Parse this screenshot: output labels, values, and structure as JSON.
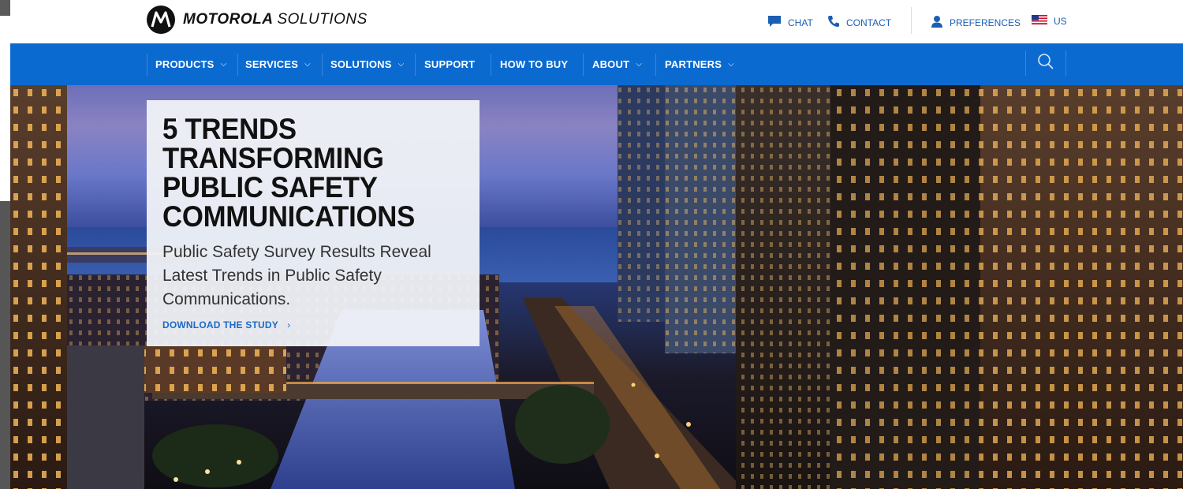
{
  "brand": {
    "name_bold": "MOTOROLA",
    "name_light": "SOLUTIONS",
    "logo_icon": "motorola-m-logo-icon"
  },
  "utility": {
    "chat": "CHAT",
    "contact": "CONTACT",
    "preferences": "PREFERENCES",
    "region": "US"
  },
  "nav": {
    "items": [
      {
        "label": "PRODUCTS",
        "dropdown": true
      },
      {
        "label": "SERVICES",
        "dropdown": true
      },
      {
        "label": "SOLUTIONS",
        "dropdown": true
      },
      {
        "label": "SUPPORT",
        "dropdown": false
      },
      {
        "label": "HOW TO BUY",
        "dropdown": false
      },
      {
        "label": "ABOUT",
        "dropdown": true
      },
      {
        "label": "PARTNERS",
        "dropdown": true
      }
    ],
    "search_icon": "search-icon"
  },
  "hero": {
    "title": "5 TRENDS TRANSFORMING PUBLIC SAFETY COMMUNICATIONS",
    "subtitle": "Public Safety Survey Results Reveal Latest Trends in Public Safety Communications.",
    "cta": "DOWNLOAD THE STUDY",
    "cta_arrow": "›"
  },
  "colors": {
    "nav_blue": "#0b6ad0",
    "link_blue": "#1a6ac8",
    "dropdown_chevron": "⌵"
  }
}
